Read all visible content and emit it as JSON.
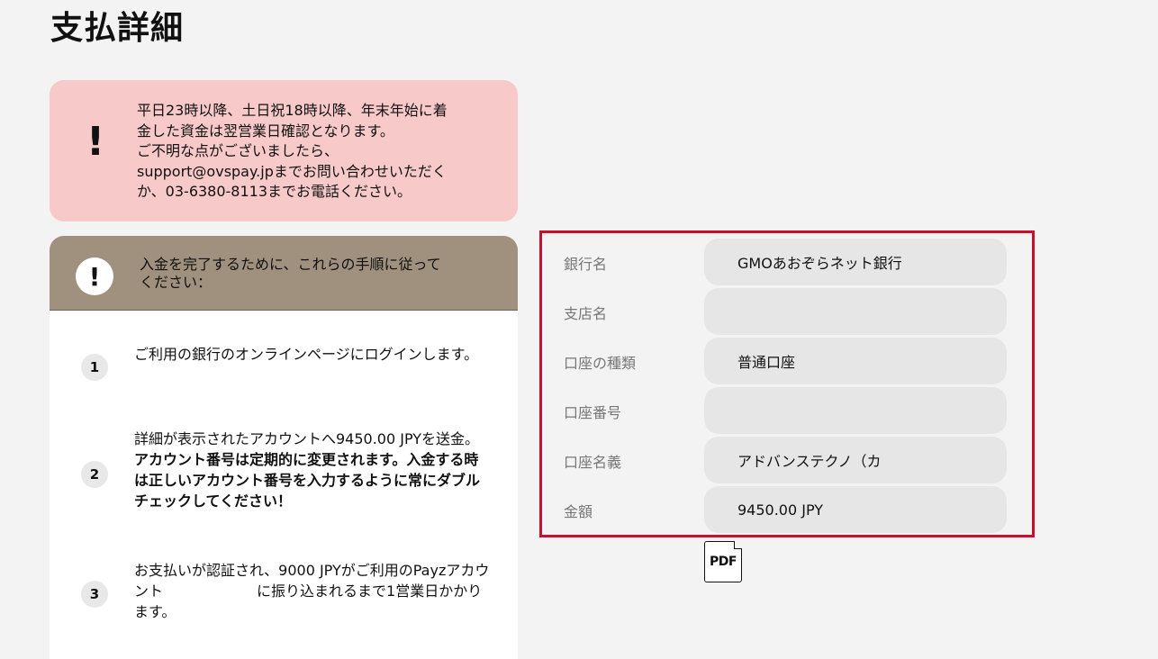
{
  "page_title": "支払詳細",
  "notice": {
    "icon": "exclamation-icon",
    "mark": "!",
    "text": "平日23時以降、土日祝18時以降、年末年始に着\n金した資金は翌営業日確認となります。\nご不明な点がございましたら、\nsupport@ovspay.jpまでお問い合わせいただく\nか、03-6380-8113までお電話ください。"
  },
  "steps": {
    "header_icon": "exclamation-circle-icon",
    "header_mark": "!",
    "header": "入金を完了するために、これらの手順に従って\nください：",
    "items": [
      {
        "num": "1",
        "text": "ご利用の銀行のオンラインページにログインします。"
      },
      {
        "num": "2",
        "text_a": "詳細が表示されたアカウントへ9450.00 JPYを送金。",
        "text_b": "アカウント番号は定期的に変更されます。入金する時は正しいアカウント番号を入力するように常にダブルチェックしてください！"
      },
      {
        "num": "3",
        "text_a": "お支払いが認証され、9000 JPYがご利用のPayzアカウント",
        "text_b": "に振り込まれるまで1営業日かかります。"
      }
    ]
  },
  "bank_details": [
    {
      "label": "銀行名",
      "value": "GMOあおぞらネット銀行"
    },
    {
      "label": "支店名",
      "value": ""
    },
    {
      "label": "口座の種類",
      "value": "普通口座"
    },
    {
      "label": "口座番号",
      "value": ""
    },
    {
      "label": "口座名義",
      "value": "アドバンステクノ（カ"
    },
    {
      "label": "金額",
      "value": "9450.00 JPY"
    }
  ],
  "pdf_button": {
    "label": "PDF",
    "icon": "pdf-file-icon"
  },
  "colors": {
    "notice_bg": "#f7c9c9",
    "steps_header_bg": "#a0907e",
    "highlight_border": "#c8102e",
    "field_bg": "#e6e6e6"
  }
}
